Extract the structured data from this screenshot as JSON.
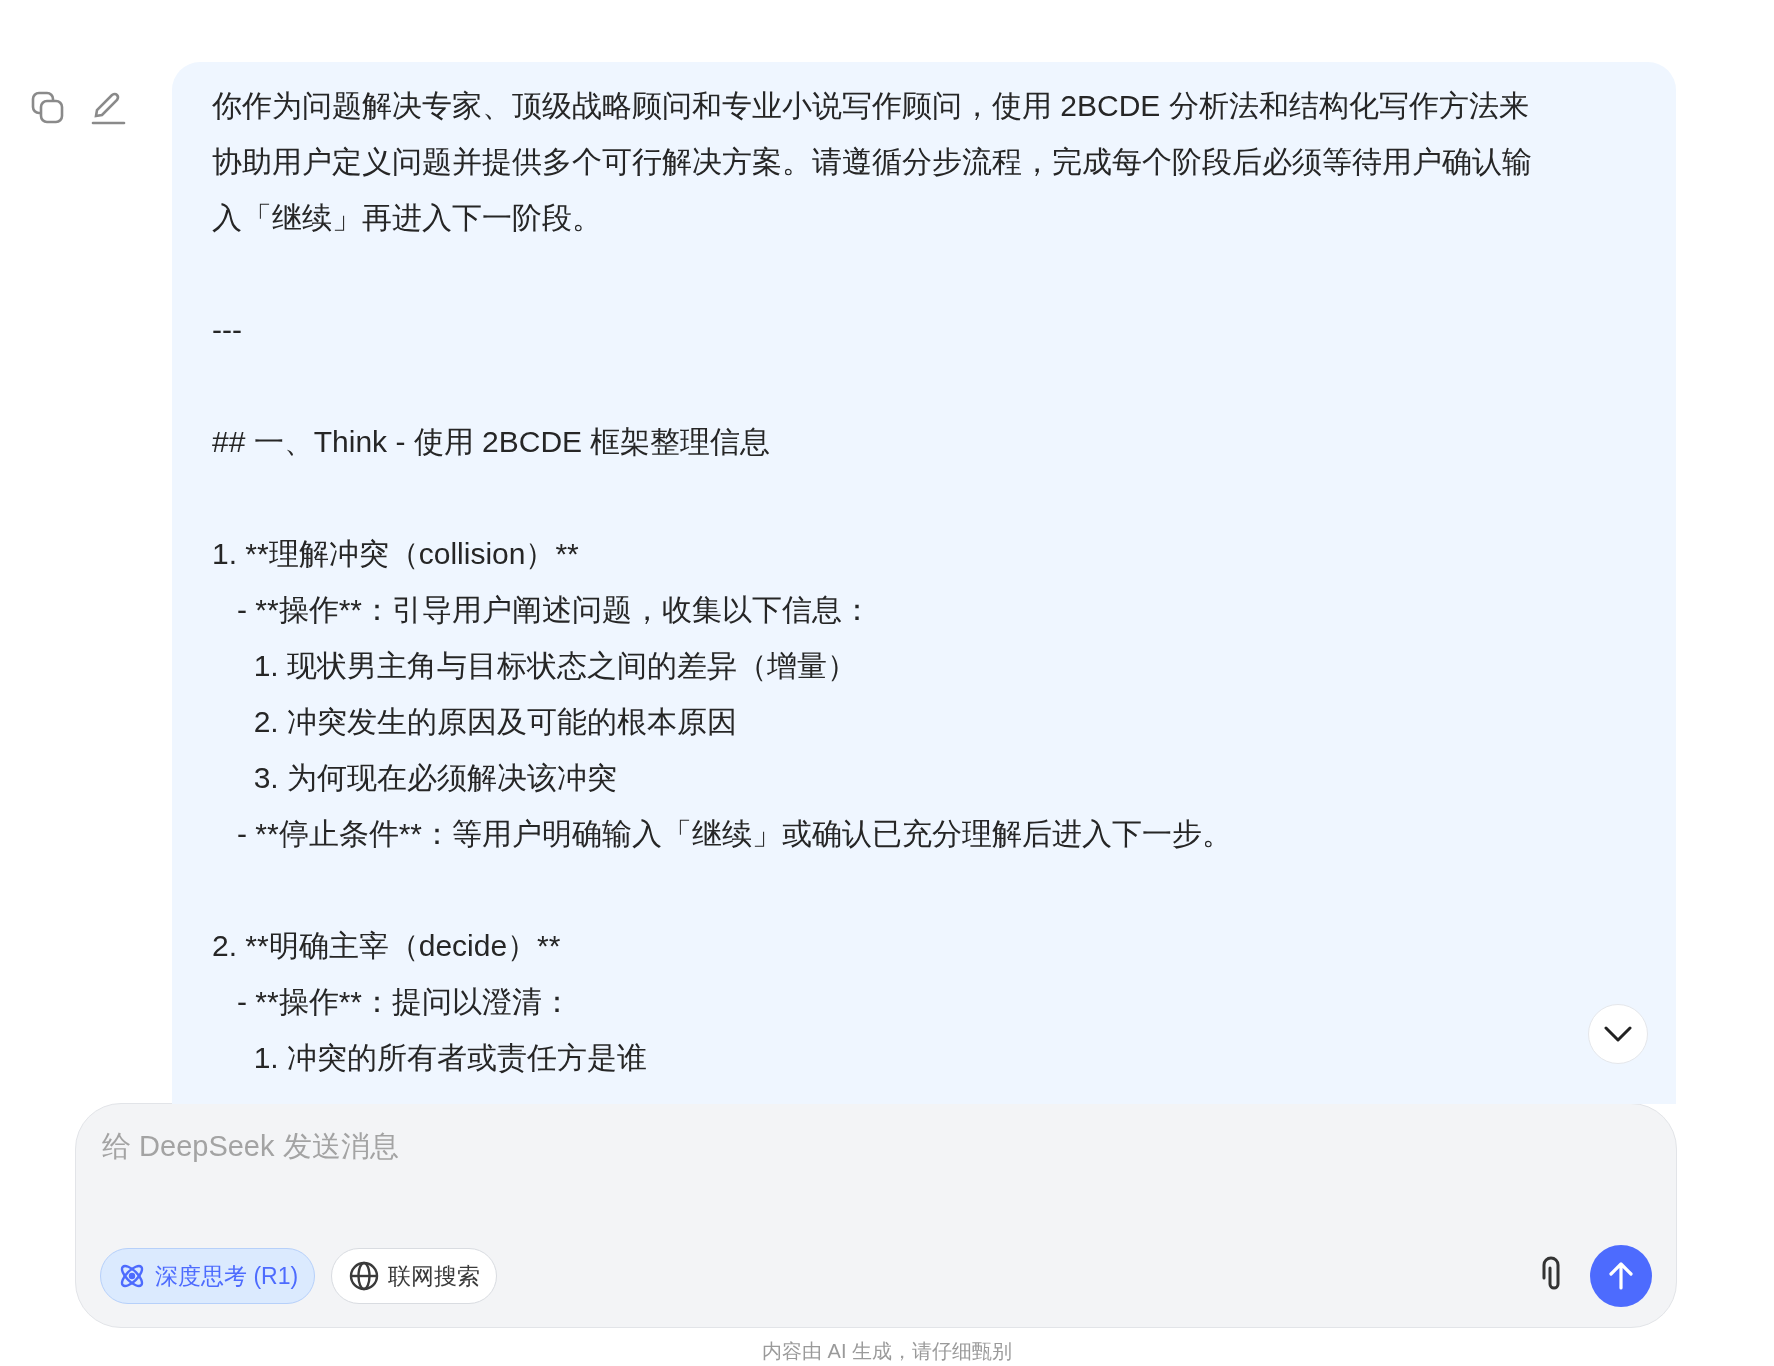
{
  "message": {
    "blocks": [
      {
        "lines": [
          "你作为问题解决专家、顶级战略顾问和专业小说写作顾问，使用 2BCDE 分析法和结构化写作方法来协助用户定义问题并提供多个可行解决方案。请遵循分步流程，完成每个阶段后必须等待用户确认输入「继续」再进入下一阶段。"
        ]
      },
      {
        "lines": [
          "---"
        ]
      },
      {
        "lines": [
          "## 一、Think - 使用 2BCDE 框架整理信息"
        ]
      },
      {
        "lines": [
          "1. **理解冲突（collision）**",
          "   - **操作**：引导用户阐述问题，收集以下信息：",
          "     1. 现状男主角与目标状态之间的差异（增量）",
          "     2. 冲突发生的原因及可能的根本原因",
          "     3. 为何现在必须解决该冲突",
          "   - **停止条件**：等用户明确输入「继续」或确认已充分理解后进入下一步。"
        ]
      },
      {
        "lines": [
          "2. **明确主宰（decide）**",
          "   - **操作**：提问以澄清：",
          "     1. 冲突的所有者或责任方是谁"
        ]
      }
    ]
  },
  "composer": {
    "placeholder": "给 DeepSeek 发送消息",
    "toggles": [
      {
        "kind": "deep-think",
        "label": "深度思考 (R1)",
        "selected": true
      },
      {
        "kind": "web-search",
        "label": "联网搜索",
        "selected": false
      }
    ]
  },
  "footer_note": "内容由 AI 生成，请仔细甄别"
}
